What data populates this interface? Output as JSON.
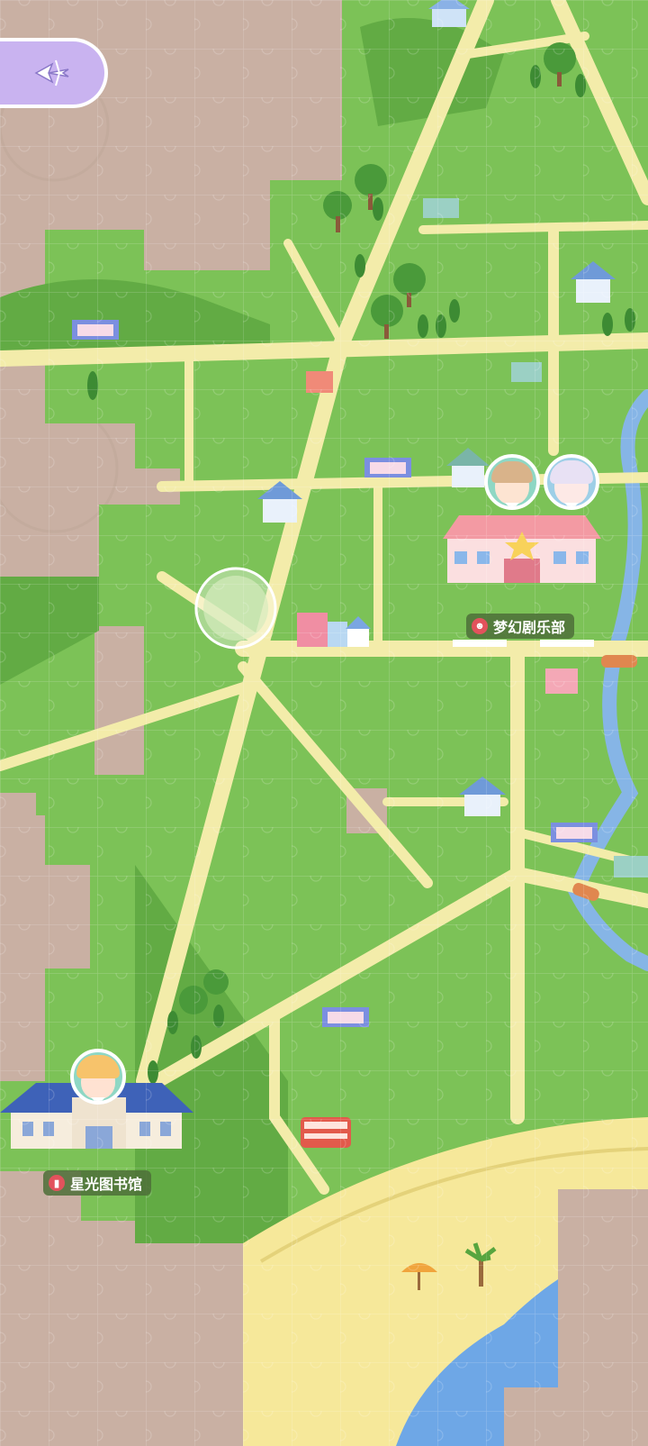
{
  "map": {
    "landmarks": {
      "theater_name": "梦幻剧乐部",
      "library_name": "星光图书馆"
    },
    "icons": {
      "back": "compass-back-icon",
      "theater_badge": "mask-icon",
      "library_badge": "book-icon"
    },
    "colors": {
      "grass": "#7cc257",
      "grass_dark": "#62ab44",
      "road": "#f3ecaa",
      "river": "#86b5e6",
      "beach": "#f6e89a",
      "sea": "#6ea7e6",
      "background": "#c9b0a3",
      "back_button": "#c9b3f0"
    },
    "characters": [
      {
        "name": "brown-haired-character",
        "color": "#d9b38a"
      },
      {
        "name": "white-haired-character",
        "color": "#e8e1f4"
      },
      {
        "name": "blonde-character",
        "color": "#f7c36b"
      }
    ]
  }
}
